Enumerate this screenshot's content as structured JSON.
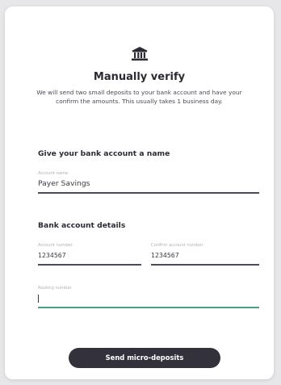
{
  "header": {
    "icon": "bank-icon",
    "title": "Manually verify",
    "description": "We will send two small deposits to your bank account and have your confirm the amounts. This usually takes 1 business day."
  },
  "name_section": {
    "title": "Give your bank account a name",
    "account_name": {
      "label": "Account name",
      "value": "Payer Savings"
    }
  },
  "details_section": {
    "title": "Bank account details",
    "account_number": {
      "label": "Account number",
      "value": "1234567"
    },
    "confirm_account_number": {
      "label": "Confirm account number",
      "value": "1234567"
    },
    "routing_number": {
      "label": "Routing number",
      "value": ""
    }
  },
  "actions": {
    "submit_label": "Send micro-deposits"
  },
  "colors": {
    "button": "#33313c",
    "active_underline": "#4c9d86",
    "underline": "#4b4b57"
  }
}
